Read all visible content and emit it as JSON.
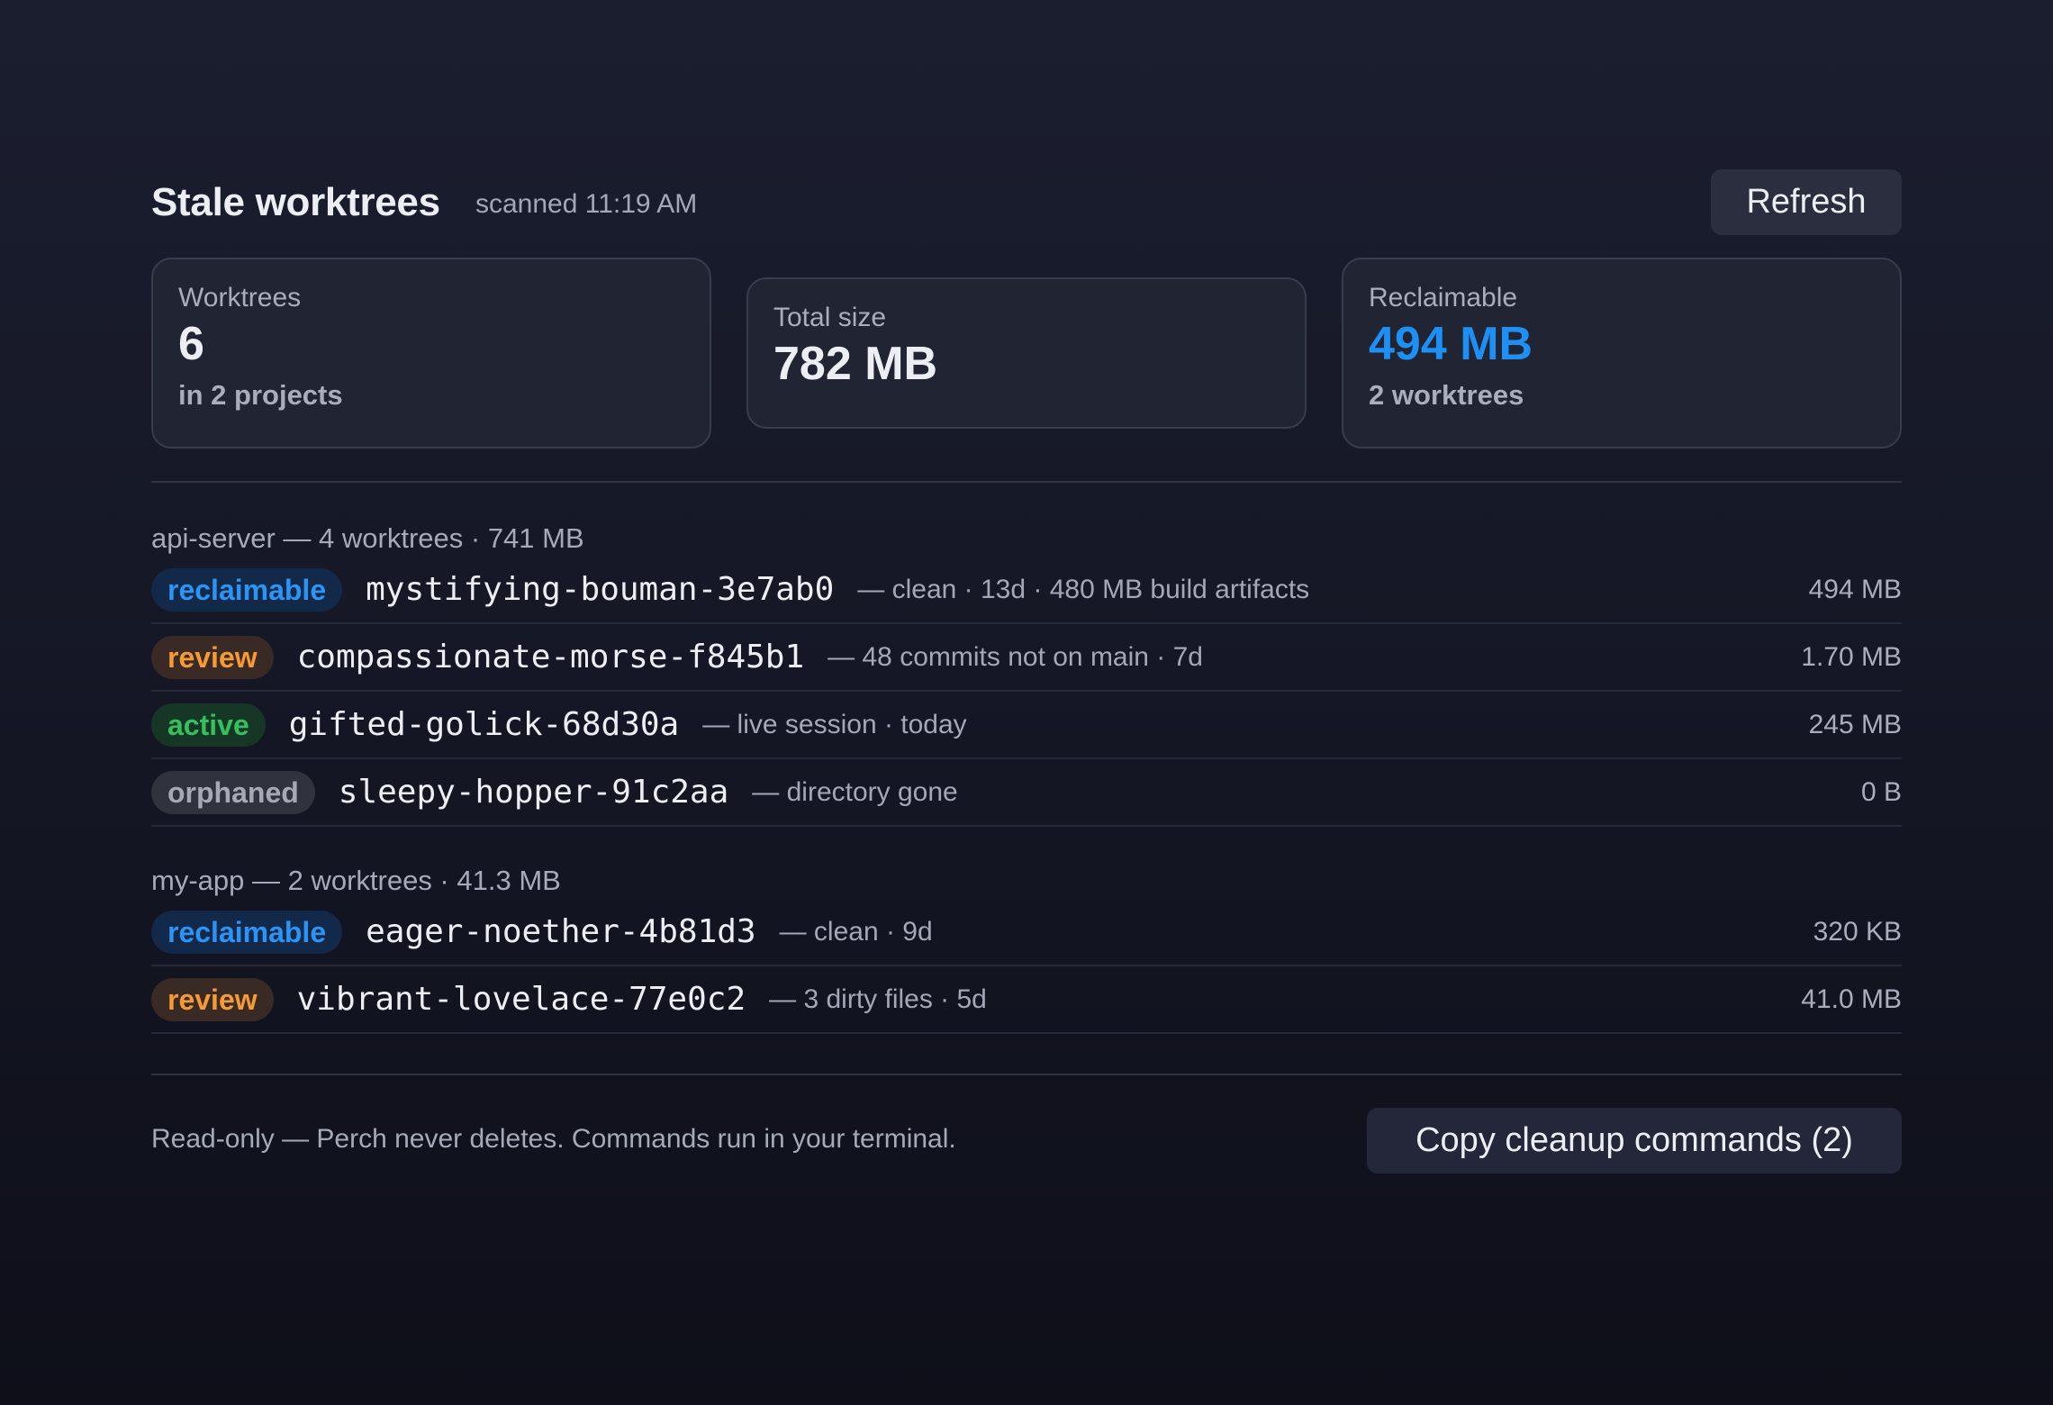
{
  "header": {
    "title": "Stale worktrees",
    "scanned": "scanned 11:19 AM",
    "refresh_label": "Refresh"
  },
  "cards": [
    {
      "label": "Worktrees",
      "value": "6",
      "sub": "in 2 projects"
    },
    {
      "label": "Total size",
      "value": "782 MB"
    },
    {
      "label": "Reclaimable",
      "value": "494 MB",
      "sub": "2 worktrees",
      "value_color": "#1e8ff5"
    }
  ],
  "groups": [
    {
      "label": "api-server — 4 worktrees · 741 MB",
      "rows": [
        {
          "status": "reclaimable",
          "name": "mystifying-bouman-3e7ab0",
          "desc": "— clean · 13d · 480 MB build artifacts",
          "size": "494 MB"
        },
        {
          "status": "review",
          "name": "compassionate-morse-f845b1",
          "desc": "— 48 commits not on main · 7d",
          "size": "1.70 MB"
        },
        {
          "status": "active",
          "name": "gifted-golick-68d30a",
          "desc": "— live session · today",
          "size": "245 MB"
        },
        {
          "status": "orphaned",
          "name": "sleepy-hopper-91c2aa",
          "desc": "— directory gone",
          "size": "0 B"
        }
      ]
    },
    {
      "label": "my-app — 2 worktrees · 41.3 MB",
      "rows": [
        {
          "status": "reclaimable",
          "name": "eager-noether-4b81d3",
          "desc": "— clean · 9d",
          "size": "320 KB"
        },
        {
          "status": "review",
          "name": "vibrant-lovelace-77e0c2",
          "desc": "— 3 dirty files · 5d",
          "size": "41.0 MB"
        }
      ]
    }
  ],
  "footer": {
    "note": "Read-only — Perch never deletes. Commands run in your terminal.",
    "copy_label": "Copy cleanup commands (2)"
  },
  "colors": {
    "reclaimable": "#2b94f5",
    "review": "#f59a34",
    "active": "#33c05d",
    "orphaned": "#a5a8b5"
  }
}
